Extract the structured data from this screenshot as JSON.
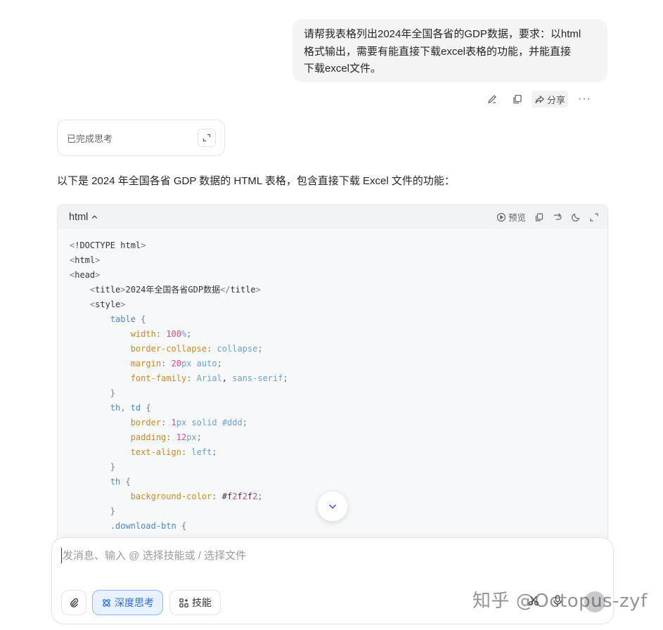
{
  "user_message": {
    "text": "请帮我表格列出2024年全国各省的GDP数据，要求：以html\n格式输出，需要有能直接下载excel表格的功能，并能直接\n下载excel文件。"
  },
  "message_actions": {
    "share_label": "分享",
    "more_label": "···"
  },
  "thinking": {
    "label": "已完成思考"
  },
  "assistant": {
    "intro": "以下是 2024 年全国各省 GDP 数据的 HTML 表格，包含直接下载 Excel 文件的功能："
  },
  "code_block": {
    "language": "html",
    "preview_label": "预览",
    "lines": [
      "<!DOCTYPE html>",
      "<html>",
      "<head>",
      "    <title>2024年全国各省GDP数据</title>",
      "    <style>",
      "        table {",
      "            width: 100%;",
      "            border-collapse: collapse;",
      "            margin: 20px auto;",
      "            font-family: Arial, sans-serif;",
      "        }",
      "        th, td {",
      "            border: 1px solid #ddd;",
      "            padding: 12px;",
      "            text-align: left;",
      "        }",
      "        th {",
      "            background-color: #f2f2f2;",
      "        }",
      "        .download-btn {"
    ]
  },
  "composer": {
    "placeholder": "发消息、输入 @ 选择技能或 / 选择文件",
    "deep_think_label": "深度思考",
    "skill_label": "技能"
  },
  "watermark": {
    "text": "知乎 @Octopus-zyf"
  }
}
